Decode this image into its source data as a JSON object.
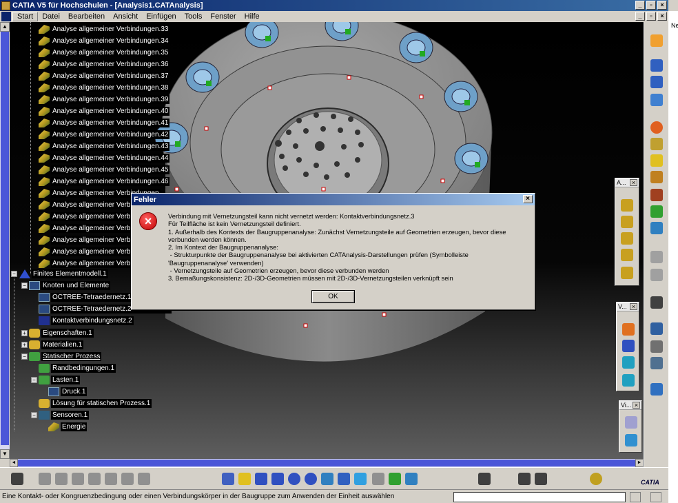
{
  "window": {
    "title": "CATIA V5 für Hochschulen - [Analysis1.CATAnalysis]",
    "side_label": "Ne"
  },
  "menu": [
    "Start",
    "Datei",
    "Bearbeiten",
    "Ansicht",
    "Einfügen",
    "Tools",
    "Fenster",
    "Hilfe"
  ],
  "tree": {
    "connections": [
      "Analyse allgemeiner Verbindungen.33",
      "Analyse allgemeiner Verbindungen.34",
      "Analyse allgemeiner Verbindungen.35",
      "Analyse allgemeiner Verbindungen.36",
      "Analyse allgemeiner Verbindungen.37",
      "Analyse allgemeiner Verbindungen.38",
      "Analyse allgemeiner Verbindungen.39",
      "Analyse allgemeiner Verbindungen.40",
      "Analyse allgemeiner Verbindungen.41",
      "Analyse allgemeiner Verbindungen.42",
      "Analyse allgemeiner Verbindungen.43",
      "Analyse allgemeiner Verbindungen.44",
      "Analyse allgemeiner Verbindungen.45",
      "Analyse allgemeiner Verbindungen.46",
      "Analyse allgemeiner Verbindungen",
      "Analyse allgemeiner Verbindungen",
      "Analyse allgemeiner Verbindungen",
      "Analyse allgemeiner Verbindungen",
      "Analyse allgemeiner Verbindungen",
      "Analyse allgemeiner Verbindungen",
      "Analyse allgemeiner Verbindungen"
    ],
    "fem": "Finites Elementmodell.1",
    "nodes_elements": "Knoten und Elemente",
    "mesh1": "OCTREE-Tetraedernetz.1 : H",
    "mesh2": "OCTREE-Tetraedernetz.2 : Lok Dom.1",
    "contact_mesh": "Kontaktverbindungsnetz.2",
    "properties": "Eigenschaften.1",
    "materials": "Materialien.1",
    "static_process": "Statischer Prozess",
    "boundary": "Randbedingungen.1",
    "loads": "Lasten.1",
    "pressure": "Druck.1",
    "solution": "Lösung für statischen Prozess.1",
    "sensors": "Sensoren.1",
    "energy": "Energie"
  },
  "toolbars": {
    "t1": "A...",
    "t2": "V...",
    "t3": "Vi..."
  },
  "dialog": {
    "title": "Fehler",
    "lines": [
      "Verbindung mit Vernetzungsteil kann nicht vernetzt werden: Kontaktverbindungsnetz.3",
      "Für Teilfläche ist kein Vernetzungsteil definiert.",
      "1. Außerhalb des Kontexts der Baugruppenanalyse: Zunächst Vernetzungsteile auf Geometrien erzeugen, bevor diese verbunden werden können.",
      "2. Im Kontext der Baugruppenanalyse:",
      " - Strukturpunkte der Baugruppenanalyse bei aktivierten CATAnalysis-Darstellungen prüfen (Symbolleiste 'Baugruppenanalyse' verwenden)",
      " - Vernetzungsteile auf Geometrien erzeugen, bevor diese verbunden werden",
      "3. Bemaßungskonsistenz: 2D-/3D-Geometrien müssen mit 2D-/3D-Vernetzungsteilen verknüpft sein"
    ],
    "ok_label": "OK"
  },
  "status": {
    "message": "Eine Kontakt- oder Kongruenzbedingung oder einen Verbindungskörper in der Baugruppe zum Anwenden der Einheit auswählen",
    "input_value": ""
  },
  "logo": "CATIA",
  "colors": {
    "title_bar": "#0a246a",
    "scroll_thumb": "#4b56d8",
    "error_red": "#c00000"
  }
}
